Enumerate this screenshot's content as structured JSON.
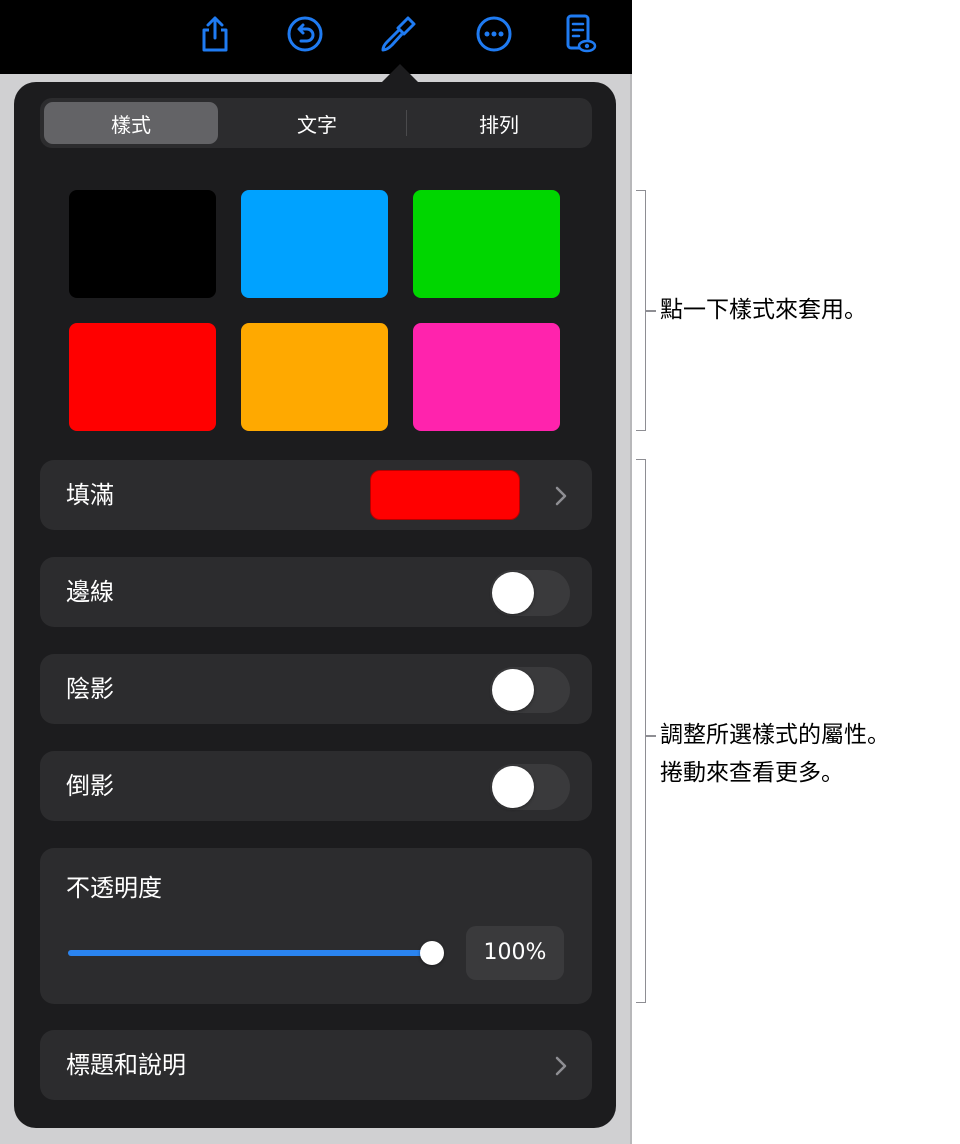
{
  "toolbar": {
    "icons": [
      "share-icon",
      "undo-icon",
      "format-brush-icon",
      "more-icon",
      "reader-view-icon"
    ],
    "accent": "#1f7bf2"
  },
  "tabs": [
    {
      "label": "樣式",
      "active": true
    },
    {
      "label": "文字",
      "active": false
    },
    {
      "label": "排列",
      "active": false
    }
  ],
  "swatches": [
    {
      "color": "#000000"
    },
    {
      "color": "#00a2ff"
    },
    {
      "color": "#00d600"
    },
    {
      "color": "#ff0000"
    },
    {
      "color": "#ffa900"
    },
    {
      "color": "#ff23ad"
    }
  ],
  "fill": {
    "label": "填滿",
    "color": "#ff0000"
  },
  "border": {
    "label": "邊線",
    "on": false
  },
  "shadow": {
    "label": "陰影",
    "on": false
  },
  "reflection": {
    "label": "倒影",
    "on": false
  },
  "opacity": {
    "label": "不透明度",
    "value": 100,
    "value_text": "100%"
  },
  "caption": {
    "label": "標題和說明"
  },
  "callouts": {
    "styles": "點一下樣式來套用。",
    "properties_line1": "調整所選樣式的屬性。",
    "properties_line2": "捲動來查看更多。"
  }
}
